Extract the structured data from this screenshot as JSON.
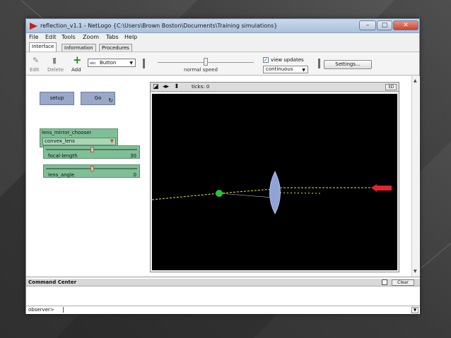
{
  "window": {
    "title": "reflection_v1.1 - NetLogo {C:\\Users\\Brown Boston\\Documents\\Training simulations}",
    "minimize": "–",
    "maximize": "□",
    "close": "✕"
  },
  "menu": [
    "File",
    "Edit",
    "Tools",
    "Zoom",
    "Tabs",
    "Help"
  ],
  "tabs": [
    "Interface",
    "Information",
    "Procedures"
  ],
  "toolbar": {
    "edit_label": "Edit",
    "delete_label": "Delete",
    "add_label": "Add",
    "widget_type": "Button",
    "widget_type_icon": "abc",
    "speed_label": "normal speed",
    "speed_value": 0.5,
    "view_updates_label": "view updates",
    "view_updates_checked": true,
    "update_mode": "continuous",
    "settings_label": "Settings..."
  },
  "widgets": {
    "setup_label": "setup",
    "go_label": "Go",
    "chooser_label": "lens_mirror_chooser",
    "chooser_value": "convex_lens",
    "sliders": [
      {
        "label": "focal-length",
        "value": "30",
        "fraction": 0.51
      },
      {
        "label": "lens_angle",
        "value": "0",
        "fraction": 0.51
      }
    ]
  },
  "view": {
    "ticks_label": "ticks: 0",
    "btn_3d": "3D",
    "background_color": "#000000",
    "ray_color": "#e6e63c",
    "source_color": "#22c442",
    "lens_color": "#8fa3d6",
    "arrow_color": "#e0262a"
  },
  "command_center": {
    "title": "Command Center",
    "clear_label": "Clear",
    "prompt": "observer>",
    "input_value": ""
  }
}
